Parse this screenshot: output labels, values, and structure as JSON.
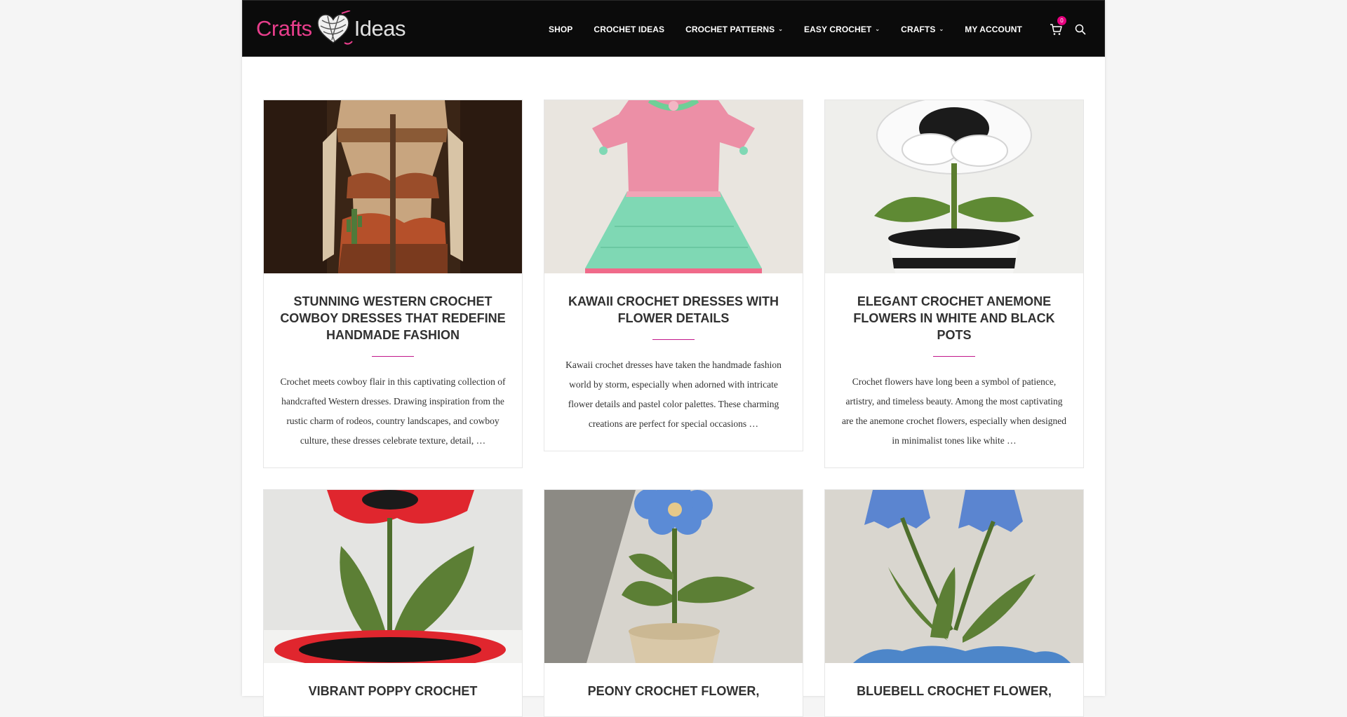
{
  "header": {
    "logo": {
      "word1": "Crafts",
      "word2": "Ideas"
    },
    "nav": [
      {
        "label": "SHOP",
        "dropdown": false
      },
      {
        "label": "CROCHET IDEAS",
        "dropdown": false
      },
      {
        "label": "CROCHET PATTERNS",
        "dropdown": true
      },
      {
        "label": "EASY CROCHET",
        "dropdown": true
      },
      {
        "label": "CRAFTS",
        "dropdown": true
      },
      {
        "label": "MY ACCOUNT",
        "dropdown": false
      }
    ],
    "cart_count": "0",
    "icons": {
      "cart": "cart-icon",
      "search": "search-icon",
      "dropdown": "chevron-down-icon"
    }
  },
  "colors": {
    "header_bg": "#0b0b0b",
    "accent": "#c2188b",
    "logo_pink": "#e83e8c",
    "badge": "#e6007e"
  },
  "posts": [
    {
      "title": "STUNNING WESTERN CROCHET COWBOY DRESSES THAT REDEFINE HANDMADE FASHION",
      "excerpt": "Crochet meets cowboy flair in this captivating collection of handcrafted Western dresses. Drawing inspiration from the rustic charm of rodeos, country landscapes, and cowboy culture, these dresses celebrate texture, detail, …"
    },
    {
      "title": "KAWAII CROCHET DRESSES WITH FLOWER DETAILS",
      "excerpt": "Kawaii crochet dresses have taken the handmade fashion world by storm, especially when adorned with intricate flower details and pastel color palettes. These charming creations are perfect for special occasions …"
    },
    {
      "title": "ELEGANT CROCHET ANEMONE FLOWERS IN WHITE AND BLACK POTS",
      "excerpt": "Crochet flowers have long been a symbol of patience, artistry, and timeless beauty. Among the most captivating are the anemone crochet flowers, especially when designed in minimalist tones like white …"
    },
    {
      "title": "VIBRANT POPPY CROCHET"
    },
    {
      "title": "PEONY CROCHET FLOWER,"
    },
    {
      "title": "BLUEBELL CROCHET FLOWER,"
    }
  ]
}
